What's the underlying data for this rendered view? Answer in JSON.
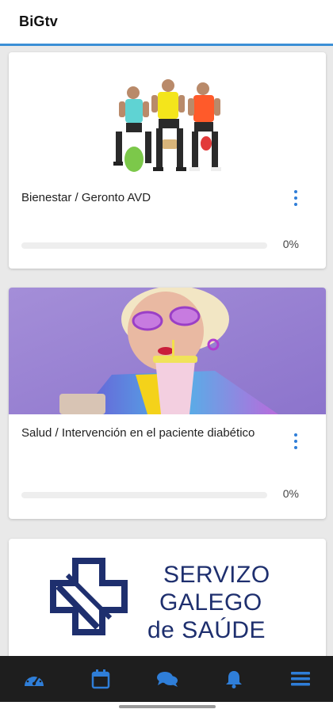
{
  "app": {
    "title": "BiGtv"
  },
  "courses": [
    {
      "title": "Bienestar / Geronto AVD",
      "progress": 0,
      "progress_label": "0%",
      "image": "three-men-seated-exercise-photo"
    },
    {
      "title": "Salud / Intervención en el paciente diabético",
      "progress": 0,
      "progress_label": "0%",
      "image": "elderly-woman-drinking-smoothie-photo"
    },
    {
      "logo_text": [
        "SERVIZO",
        "GALEGO",
        "de SAÚDE"
      ],
      "image": "servizo-galego-de-saude-logo"
    }
  ],
  "tabbar": {
    "items": [
      {
        "icon": "dashboard-gauge-icon"
      },
      {
        "icon": "calendar-icon"
      },
      {
        "icon": "chat-bubbles-icon"
      },
      {
        "icon": "bell-icon"
      },
      {
        "icon": "menu-icon"
      }
    ],
    "accent": "#2f7ed8",
    "background": "#1e1e1e"
  },
  "colors": {
    "accent": "#3b8fd6",
    "page_bg": "#e9e9e9"
  }
}
